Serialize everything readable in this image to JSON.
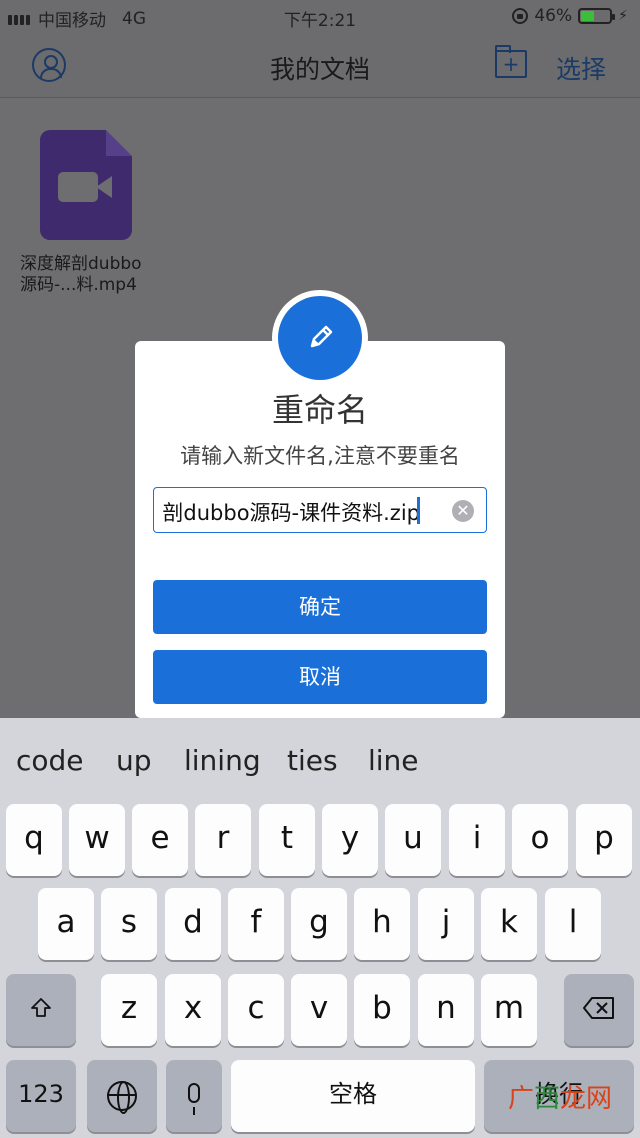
{
  "status_bar": {
    "carrier": "中国移动",
    "network": "4G",
    "time": "下午2:21",
    "battery_pct": "46%"
  },
  "nav": {
    "title": "我的文档",
    "select_label": "选择",
    "new_folder_glyph": "+"
  },
  "file": {
    "name_line1": "深度解剖dubbo",
    "name_line2": "源码-...料.mp4"
  },
  "dialog": {
    "title": "重命名",
    "subtitle": "请输入新文件名,注意不要重名",
    "input_value": "剖dubbo源码-课件资料.zip",
    "clear_glyph": "✕",
    "confirm_label": "确定",
    "cancel_label": "取消"
  },
  "keyboard": {
    "suggestions": [
      "code",
      "up",
      "lining",
      "ties",
      "line"
    ],
    "row1": [
      "q",
      "w",
      "e",
      "r",
      "t",
      "y",
      "u",
      "i",
      "o",
      "p"
    ],
    "row2": [
      "a",
      "s",
      "d",
      "f",
      "g",
      "h",
      "j",
      "k",
      "l"
    ],
    "row3": [
      "z",
      "x",
      "c",
      "v",
      "b",
      "n",
      "m"
    ],
    "num_label": "123",
    "space_label": "空格",
    "return_label": "换行"
  },
  "watermark": {
    "part1": "广",
    "part2": "西",
    "part3": "龙网"
  },
  "colors": {
    "accent": "#1a6fd8",
    "file_icon": "#3f2a6e"
  }
}
